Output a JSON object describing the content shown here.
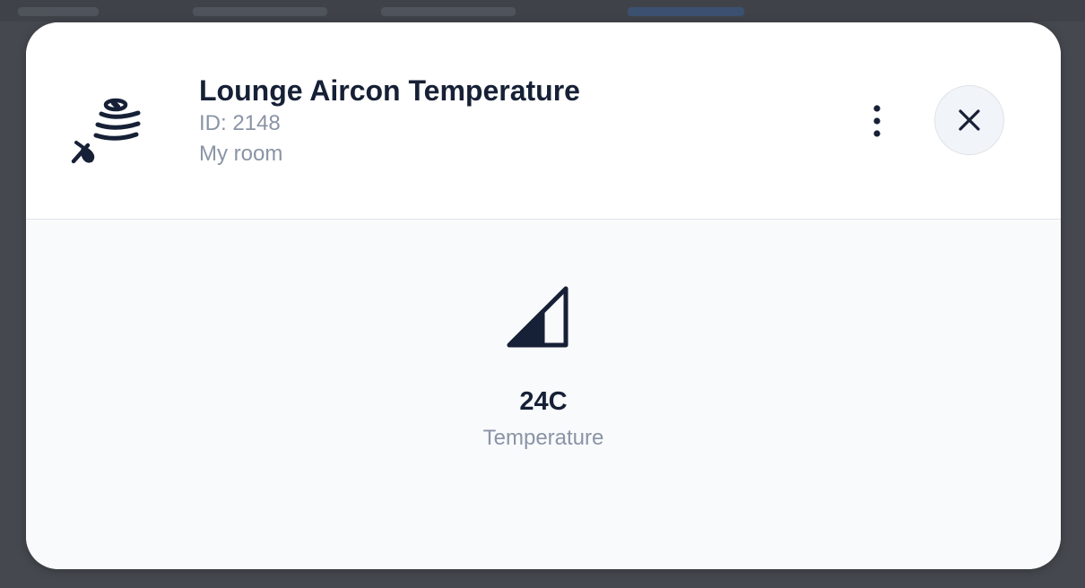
{
  "device": {
    "title": "Lounge Aircon Temperature",
    "id_text": "ID: 2148",
    "room": "My room",
    "icon": "iot-hub-device-icon"
  },
  "header_actions": {
    "more_icon": "more-vertical-icon",
    "close_icon": "close-icon"
  },
  "reading": {
    "icon": "signal-level-icon",
    "value": "24C",
    "label": "Temperature"
  },
  "colors": {
    "primary_text": "#162036",
    "secondary_text": "#8a94a5",
    "header_bg": "#ffffff",
    "body_bg": "#f9fafc",
    "close_button_bg": "#f1f4f8",
    "overlay": "#45494f"
  }
}
